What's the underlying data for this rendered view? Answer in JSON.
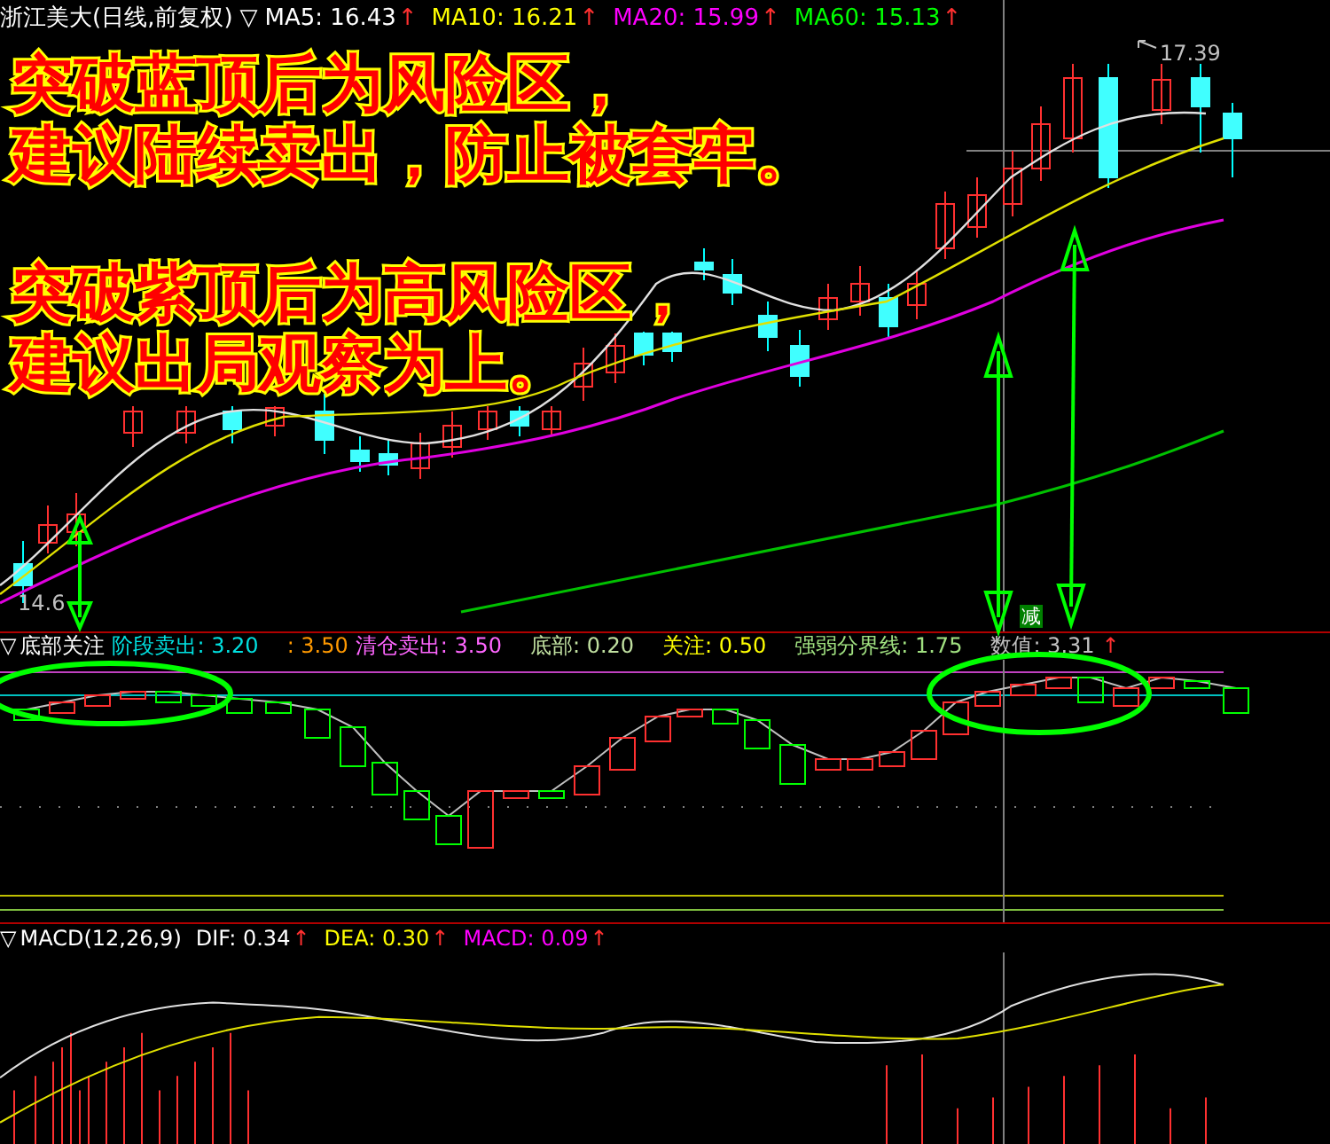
{
  "header": {
    "title": "浙江美大(日线,前复权)",
    "marker": "▽",
    "items": [
      {
        "label": "MA5: 16.43",
        "arrow": "↑",
        "color": "#ffffff"
      },
      {
        "label": "MA10: 16.21",
        "arrow": "↑",
        "color": "#ffff00"
      },
      {
        "label": "MA20: 15.99",
        "arrow": "↑",
        "color": "#ff00ff"
      },
      {
        "label": "MA60: 15.13",
        "arrow": "↑",
        "color": "#00ff00"
      }
    ]
  },
  "price_labels": {
    "high": "17.39",
    "low": "14.6"
  },
  "annotations": [
    {
      "lines": [
        "突破蓝顶后为风险区，",
        "建议陆续卖出，防止被套牢。"
      ]
    },
    {
      "lines": [
        "突破紫顶后为高风险区，",
        "建议出局观察为上。"
      ]
    }
  ],
  "signal_label": "减",
  "indicator": {
    "marker": "▽",
    "items": [
      {
        "label": "底部关注",
        "color": "#ffffff"
      },
      {
        "label": "阶段卖出: 3.20",
        "color": "#00e0e0"
      },
      {
        "label": ": 3.50",
        "color": "#ff9900"
      },
      {
        "label": "清仓卖出: 3.50",
        "color": "#ff66ff"
      },
      {
        "label": "底部: 0.20",
        "color": "#c0e0a0"
      },
      {
        "label": "关注: 0.50",
        "color": "#ffff00"
      },
      {
        "label": "强弱分界线: 1.75",
        "color": "#a0e080"
      },
      {
        "label": "数值: 3.31",
        "color": "#c0c0c0"
      }
    ],
    "arrow": "↑"
  },
  "macd": {
    "marker": "▽",
    "title": "MACD(12,26,9)",
    "items": [
      {
        "label": "DIF: 0.34",
        "arrow": "↑",
        "color": "#ffffff"
      },
      {
        "label": "DEA: 0.30",
        "arrow": "↑",
        "color": "#ffff00"
      },
      {
        "label": "MACD: 0.09",
        "arrow": "↑",
        "color": "#ff00ff"
      }
    ]
  }
}
